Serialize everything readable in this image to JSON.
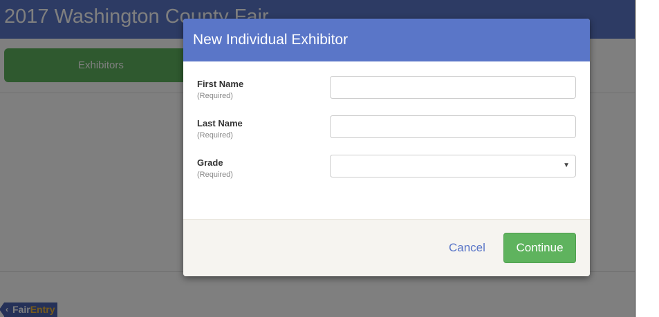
{
  "app": {
    "title": "2017 Washington County Fair",
    "nav": {
      "exhibitors_label": "Exhibitors"
    },
    "brand": {
      "part1": "Fair",
      "part2": "Entry",
      "accent_color": "#f0b637"
    },
    "header_color": "#5a76c8"
  },
  "modal": {
    "title": "New Individual Exhibitor",
    "fields": [
      {
        "label": "First Name",
        "help": "(Required)",
        "value": "",
        "type": "text"
      },
      {
        "label": "Last Name",
        "help": "(Required)",
        "value": "",
        "type": "text"
      },
      {
        "label": "Grade",
        "help": "(Required)",
        "value": "",
        "type": "select"
      }
    ],
    "cancel_label": "Cancel",
    "continue_label": "Continue",
    "continue_color": "#5fb35e"
  }
}
